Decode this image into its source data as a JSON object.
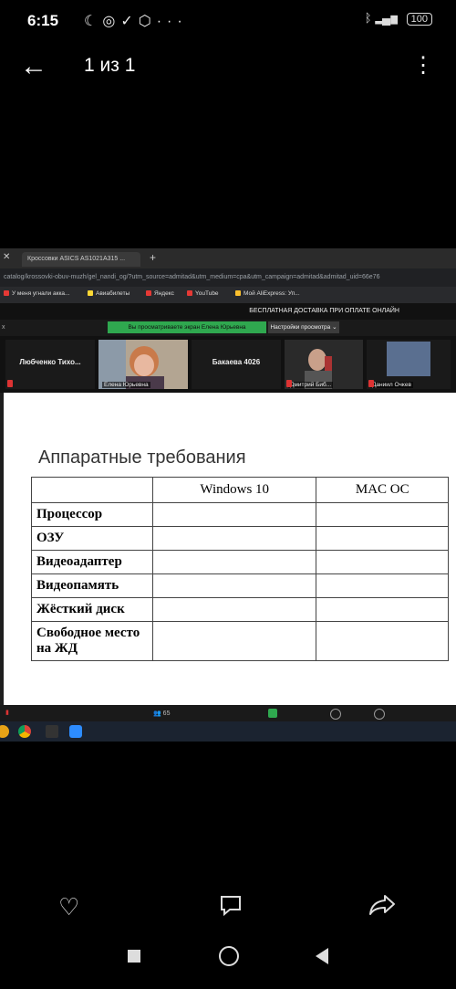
{
  "status_bar": {
    "time": "6:15",
    "icons": [
      "moon-icon",
      "whatsapp-icon",
      "check-download-icon",
      "shield-icon",
      "more-dots-icon"
    ],
    "right_icons": [
      "bluetooth-icon",
      "signal-icon"
    ],
    "battery": "100"
  },
  "header": {
    "counter": "1 из 1",
    "back_icon": "←",
    "more_icon": "⋮"
  },
  "photo": {
    "browser": {
      "tab_title": "Кроссовки ASICS AS1021A315 ...",
      "url": "catalog/krossovki-obuv-muzh/gel_nandi_og/?utm_source=admitad&utm_medium=cpa&utm_campaign=admitad&admitad_uid=66e76",
      "bookmarks": [
        {
          "label": "У меня угнали акка...",
          "color": "#e53935"
        },
        {
          "label": "Авиабилеты",
          "color": "#fdd835"
        },
        {
          "label": "Яндекс",
          "color": "#e53935"
        },
        {
          "label": "YouTube",
          "color": "#e53935"
        },
        {
          "label": "Мой AliExpress: Уп...",
          "color": "#fbc02d"
        }
      ],
      "promo": "БЕСПЛАТНАЯ ДОСТАВКА ПРИ ОПЛАТЕ ОНЛАЙН"
    },
    "zoom": {
      "sharing_banner": "Вы просматриваете экран Елена Юрьевна",
      "view_options": "Настройки просмотра ⌄",
      "participants": [
        {
          "name": "Любченко Тихо...",
          "caption": ""
        },
        {
          "name": "",
          "caption": "Елена Юрьевна"
        },
        {
          "name": "Бакаева 4026",
          "caption": ""
        },
        {
          "name": "",
          "caption": "Дмитрий Биб..."
        },
        {
          "name": "",
          "caption": "Даниил Очкев"
        }
      ],
      "participants_count": "65"
    },
    "slide": {
      "title": "Аппаратные требования",
      "columns": [
        "",
        "Windows 10",
        "MAC OC"
      ],
      "rows": [
        "Процессор",
        "ОЗУ",
        "Видеоадаптер",
        "Видеопамять",
        "Жёсткий диск",
        "Свободное место на ЖД"
      ]
    }
  },
  "actions": {
    "like_icon": "♡",
    "comment_icon": "comment-icon",
    "share_icon": "share-icon"
  },
  "nav": [
    "recents-square-icon",
    "home-circle-icon",
    "back-triangle-icon"
  ]
}
